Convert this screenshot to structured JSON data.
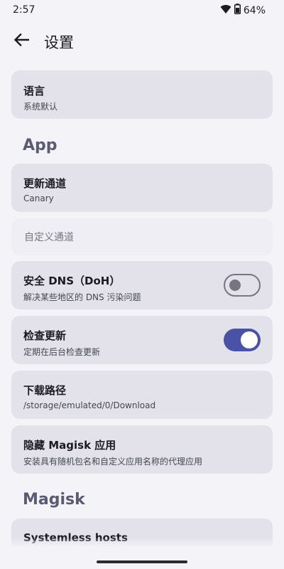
{
  "status_bar": {
    "time": "2:57",
    "battery": "64%",
    "icons": [
      "wifi-icon",
      "battery-icon"
    ]
  },
  "app_bar": {
    "title": "设置",
    "back_icon": "arrow-left-icon"
  },
  "settings": {
    "language": {
      "title": "语言",
      "summary": "系统默认"
    },
    "app_section": "App",
    "update_channel": {
      "title": "更新通道",
      "summary": "Canary"
    },
    "custom_channel": {
      "placeholder": "自定义通道",
      "value": ""
    },
    "secure_dns": {
      "title": "安全 DNS（DoH）",
      "summary": "解决某些地区的 DNS 污染问题",
      "enabled": false
    },
    "check_update": {
      "title": "检查更新",
      "summary": "定期在后台检查更新",
      "enabled": true
    },
    "download_path": {
      "title": "下载路径",
      "summary": "/storage/emulated/0/Download"
    },
    "hide_app": {
      "title": "隐藏 Magisk 应用",
      "summary": "安装具有随机包名和自定义应用名称的代理应用"
    },
    "magisk_section": "Magisk",
    "systemless_hosts": {
      "title": "Systemless hosts"
    }
  },
  "colors": {
    "background": "#f4f3f8",
    "card": "#e3e2ea",
    "accent": "#4a52a5",
    "section_header": "#595b70"
  }
}
